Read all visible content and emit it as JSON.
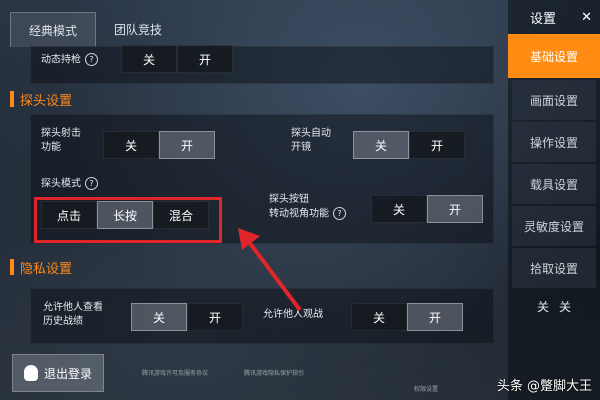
{
  "tabs": [
    "经典模式",
    "团队竞技"
  ],
  "dynamic_fire": {
    "label": "动态持枪",
    "off": "关",
    "on": "开"
  },
  "peek_section": {
    "title": "探头设置",
    "peek_fire": {
      "label": [
        "探头射击",
        "功能"
      ],
      "off": "关",
      "on": "开"
    },
    "peek_auto_scope": {
      "label": [
        "探头自动",
        "开镜"
      ],
      "off": "关",
      "on": "开"
    },
    "peek_mode": {
      "label": "探头模式",
      "options": [
        "点击",
        "长按",
        "混合"
      ]
    },
    "peek_button_view": {
      "label": [
        "探头按钮",
        "转动视角功能"
      ],
      "off": "关",
      "on": "开"
    }
  },
  "privacy_section": {
    "title": "隐私设置",
    "allow_view_record": {
      "label": [
        "允许他人查看",
        "历史战绩"
      ],
      "off": "关",
      "on": "开"
    },
    "allow_spectate": {
      "label": "允许他人观战",
      "off": "关",
      "on": "开"
    }
  },
  "sidebar": {
    "title": "设置",
    "close": "✕",
    "items": [
      "基础设置",
      "画面设置",
      "操作设置",
      "载具设置",
      "灵敏度设置",
      "拾取设置",
      "关",
      "关"
    ]
  },
  "footer": {
    "login": "退出登录",
    "link1": "腾讯游戏许可及服务协议",
    "link2": "腾讯游戏隐私保护指引",
    "link3": "权限设置"
  },
  "watermark": "头条 @蹩脚大王"
}
